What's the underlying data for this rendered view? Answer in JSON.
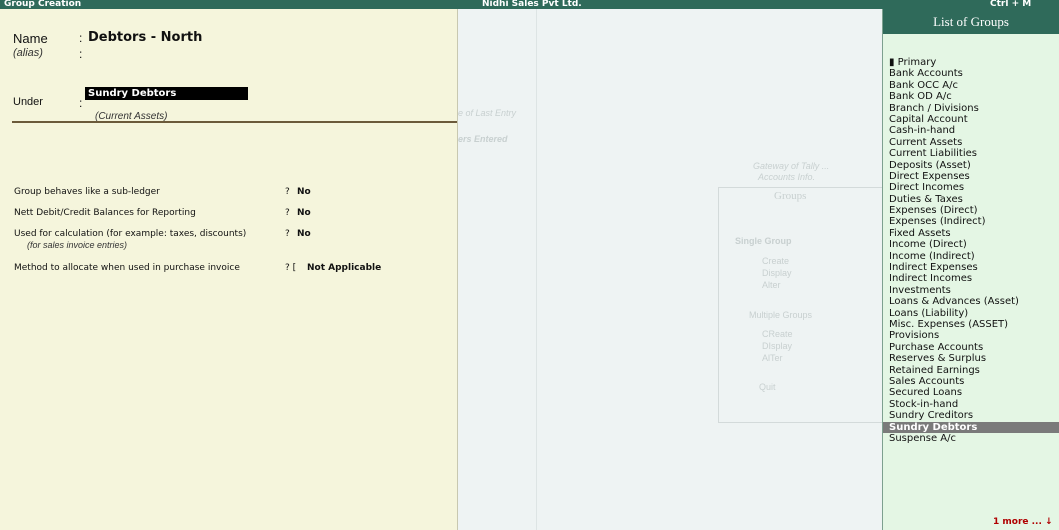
{
  "topbar": {
    "left_title": "Group Creation",
    "company": "Nidhi Sales Pvt Ltd.",
    "shortcut": "Ctrl + M"
  },
  "form": {
    "name_label": "Name",
    "name_colon": ":",
    "name_value": "Debtors - North",
    "alias_label": "(alias)",
    "alias_colon": ":",
    "under_label": "Under",
    "under_colon": ":",
    "under_value": "Sundry Debtors",
    "under_sub": "(Current Assets)",
    "rows": [
      {
        "label": "Group behaves like a sub-ledger",
        "q": "?",
        "value": "No"
      },
      {
        "label": "Nett Debit/Credit Balances for Reporting",
        "q": "?",
        "value": "No"
      },
      {
        "label": "Used for calculation (for example: taxes, discounts)",
        "q": "?",
        "value": "No",
        "sub": "(for sales invoice entries)"
      },
      {
        "label": "Method to allocate when used in purchase invoice",
        "q": "? [",
        "value": "Not Applicable"
      }
    ]
  },
  "background": {
    "last_entry": "e of Last Entry",
    "entered": "ers Entered",
    "gateway": "Gateway of Tally ...",
    "accounts_info": "Accounts Info.",
    "groups_title": "Groups",
    "single_group": "Single Group",
    "create": "Create",
    "display": "Display",
    "alter": "Alter",
    "multiple_groups": "Multiple Groups",
    "m_create": "CReate",
    "m_display": "DIsplay",
    "m_alter": "AlTer",
    "quit": "Quit"
  },
  "list_of_groups": {
    "title": "List of Groups",
    "items": [
      "▮ Primary",
      "Bank Accounts",
      "Bank OCC A/c",
      "Bank OD A/c",
      "Branch / Divisions",
      "Capital Account",
      "Cash-in-hand",
      "Current Assets",
      "Current Liabilities",
      "Deposits (Asset)",
      "Direct Expenses",
      "Direct Incomes",
      "Duties & Taxes",
      "Expenses (Direct)",
      "Expenses (Indirect)",
      "Fixed Assets",
      "Income (Direct)",
      "Income (Indirect)",
      "Indirect Expenses",
      "Indirect Incomes",
      "Investments",
      "Loans & Advances (Asset)",
      "Loans (Liability)",
      "Misc. Expenses (ASSET)",
      "Provisions",
      "Purchase Accounts",
      "Reserves & Surplus",
      "Retained Earnings",
      "Sales Accounts",
      "Secured Loans",
      "Stock-in-hand",
      "Sundry Creditors",
      "Sundry Debtors",
      "Suspense A/c"
    ],
    "selected_item": "Sundry Debtors",
    "more": "1 more ... ↓"
  }
}
